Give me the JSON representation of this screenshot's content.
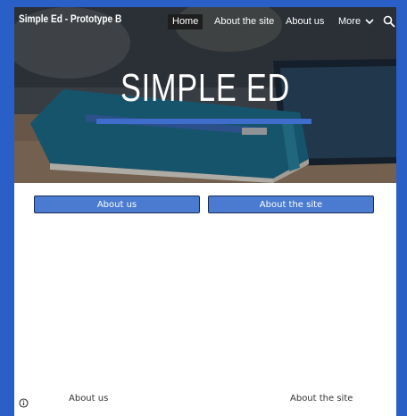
{
  "site": {
    "title": "Simple Ed - Prototype B"
  },
  "nav": {
    "items": [
      {
        "label": "Home",
        "active": true
      },
      {
        "label": "About the site",
        "active": false
      },
      {
        "label": "About us",
        "active": false
      },
      {
        "label": "More",
        "active": false
      }
    ],
    "more_icon": "chevron-down-icon",
    "search_icon": "search-icon"
  },
  "hero": {
    "title": "SIMPLE ED",
    "accent_color": "#3f6dcc"
  },
  "buttons": [
    {
      "label": "About us"
    },
    {
      "label": "About the site"
    }
  ],
  "footer": {
    "links": [
      {
        "label": "About us"
      },
      {
        "label": "About the site"
      }
    ],
    "info_icon": "info-icon"
  },
  "colors": {
    "background": "#2a5fc8",
    "button": "#4a7bd0",
    "nav_active": "#1e1e1e"
  }
}
